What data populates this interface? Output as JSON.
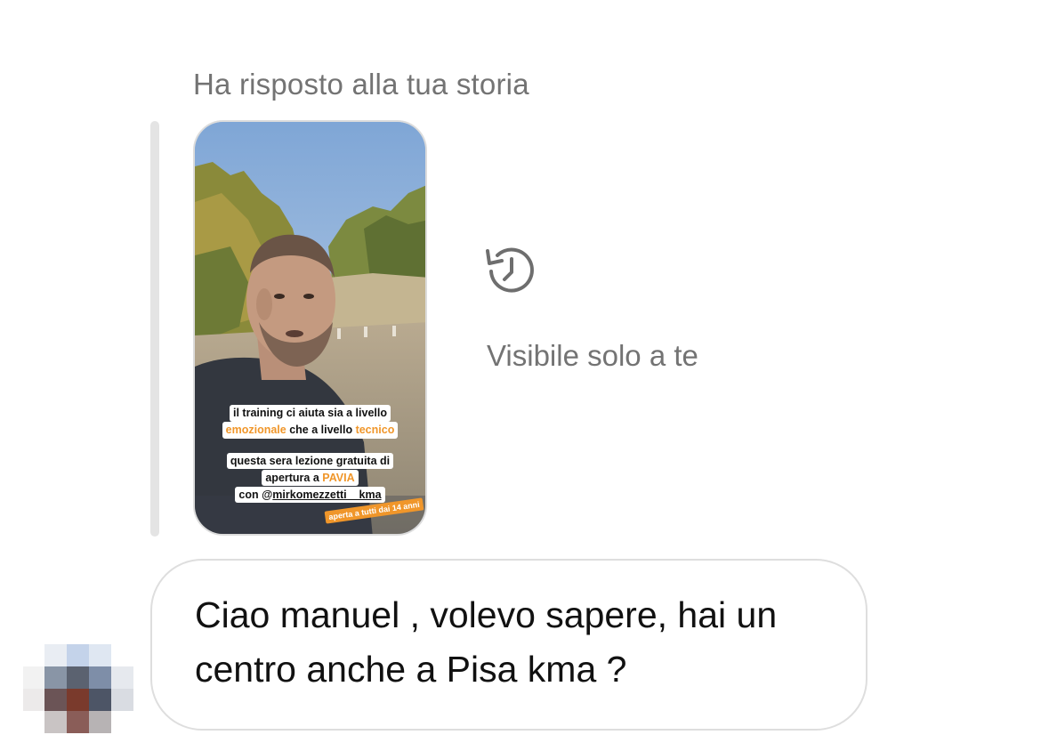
{
  "reply": {
    "header": "Ha risposto alla tua storia"
  },
  "story": {
    "caption_1": {
      "line1": "il training ci aiuta sia a livello",
      "line2_a": "emozionale",
      "line2_b": " che a livello ",
      "line2_c": "tecnico"
    },
    "caption_2": {
      "line1": "questa sera lezione gratuita di",
      "line2_a": "apertura a ",
      "line2_b": "PAVIA",
      "line3_a": "con @",
      "line3_b": "mirkomezzetti__kma"
    },
    "sticker": "aperta a tutti dai 14 anni",
    "highlight_color": "#f0962a"
  },
  "expired": {
    "icon": "history-icon",
    "text": "Visibile solo a te"
  },
  "message": {
    "text": "Ciao manuel , volevo sapere, hai un centro anche a Pisa kma ?"
  },
  "sender": {
    "avatar": "blurred-avatar"
  }
}
